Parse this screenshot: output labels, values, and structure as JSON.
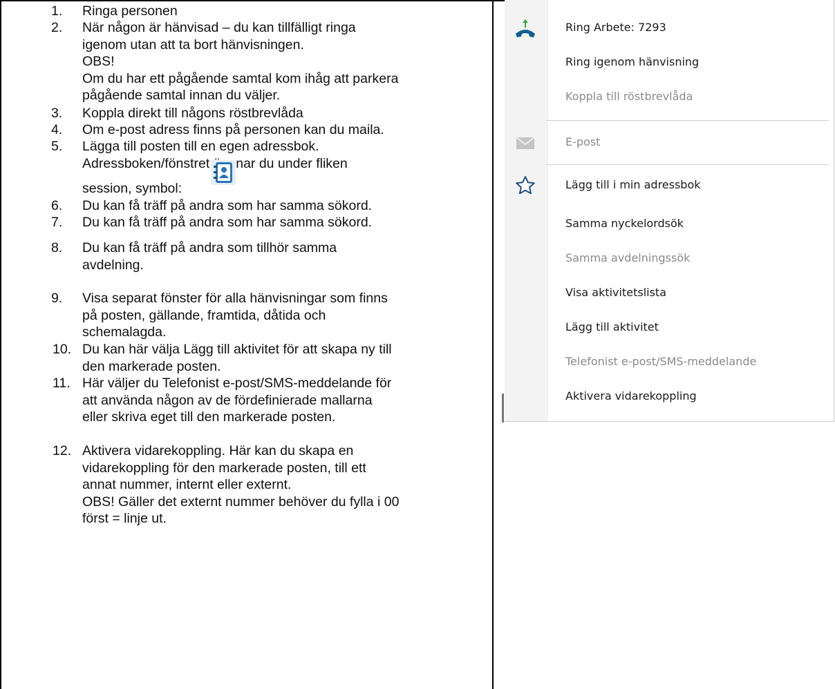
{
  "instructions": [
    {
      "num": "1.",
      "lines": [
        "Ringa personen"
      ]
    },
    {
      "num": "2.",
      "lines": [
        "När någon är hänvisad – du kan tillfälligt ringa",
        "igenom utan att ta bort hänvisningen.",
        "OBS!",
        "Om du har ett pågående samtal kom ihåg att parkera",
        "pågående samtal innan du väljer."
      ]
    },
    {
      "num": "3.",
      "lines": [
        "Koppla direkt till någons röstbrevlåda"
      ]
    },
    {
      "num": "4.",
      "lines": [
        "Om e-post adress finns på personen kan du maila."
      ]
    },
    {
      "num": "5.",
      "lines": [
        "Lägga till posten till en egen adressbok.",
        "Adressboken/fönstret öppnar du under fliken"
      ],
      "icon_line_prefix": "session, symbol:"
    },
    {
      "num": "6.",
      "lines": [
        "Du kan få träff på andra som har samma sökord."
      ]
    },
    {
      "num": "7.",
      "lines": [
        "Du kan få träff på andra som har samma sökord."
      ]
    },
    {
      "num": "8.",
      "lines": [
        "Du kan få träff på andra som tillhör samma",
        "avdelning."
      ]
    },
    {
      "num": "9.",
      "lines": [
        "Visa separat fönster för alla hänvisningar som finns",
        "på posten, gällande, framtida, dåtida och",
        "schemalagda."
      ]
    },
    {
      "num": "10.",
      "lines": [
        "Du kan här välja Lägg till aktivitet för att skapa ny till",
        "den markerade posten."
      ]
    },
    {
      "num": "11.",
      "lines": [
        "Här väljer du Telefonist e-post/SMS-meddelande för",
        "att använda någon av de fördefinierade mallarna",
        "eller skriva eget till den markerade posten."
      ]
    },
    {
      "num": "12.",
      "lines": [
        "Aktivera vidarekoppling. Här kan du skapa en",
        "vidarekoppling för den markerade posten, till ett",
        "annat nummer, internt eller externt.",
        "OBS! Gäller det externt nummer behöver du fylla i 00",
        "först = linje ut."
      ]
    }
  ],
  "menu": {
    "items": [
      {
        "label": "Ring Arbete: 7293",
        "enabled": true,
        "icon": "phone-call-icon"
      },
      {
        "label": "Ring igenom hänvisning",
        "enabled": true
      },
      {
        "label": "Koppla till röstbrevlåda",
        "enabled": false
      },
      {
        "label": "E-post",
        "enabled": false,
        "icon": "envelope-icon"
      },
      {
        "label": "Lägg till i min adressbok",
        "enabled": true,
        "icon": "star-icon"
      },
      {
        "label": "Samma nyckelordsök",
        "enabled": true
      },
      {
        "label": "Samma avdelningssök",
        "enabled": false
      },
      {
        "label": "Visa aktivitetslista",
        "enabled": true
      },
      {
        "label": "Lägg till aktivitet",
        "enabled": true
      },
      {
        "label": "Telefonist e-post/SMS-meddelande",
        "enabled": false
      },
      {
        "label": "Aktivera vidarekoppling",
        "enabled": true
      }
    ]
  },
  "colors": {
    "enabled_text": "#1b1b1b",
    "disabled_text": "#8a8a8a",
    "phone_icon": "#0f5f8f",
    "arrow_icon": "#2eaa3c",
    "star_icon": "#1f4f7a",
    "addressbook_icon": "#2a74b8"
  }
}
